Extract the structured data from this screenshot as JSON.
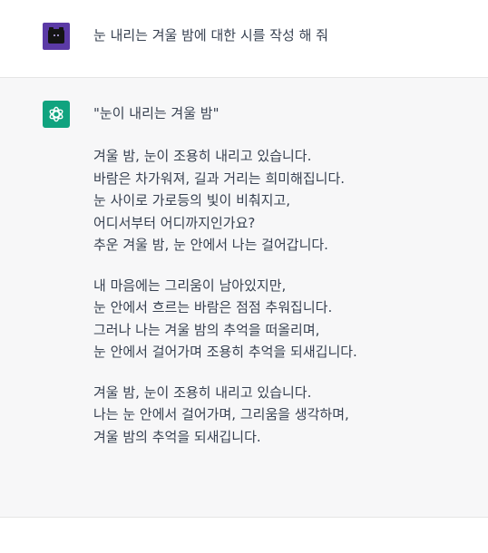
{
  "user_message": {
    "text": "눈 내리는 겨울 밤에 대한 시를 작성 해 줘",
    "avatar_color": "#5b3aa6"
  },
  "assistant_message": {
    "avatar_color": "#10a37f",
    "title": "\"눈이 내리는 겨울 밤\"",
    "stanzas": [
      {
        "lines": [
          "겨울 밤, 눈이 조용히 내리고 있습니다.",
          "바람은 차가워져, 길과 거리는 희미해집니다.",
          "눈 사이로 가로등의 빛이 비춰지고,",
          "어디서부터 어디까지인가요?",
          "추운 겨울 밤, 눈 안에서 나는 걸어갑니다."
        ]
      },
      {
        "lines": [
          "내 마음에는 그리움이 남아있지만,",
          "눈 안에서 흐르는 바람은 점점 추워집니다.",
          "그러나 나는 겨울 밤의 추억을 떠올리며,",
          "눈 안에서 걸어가며 조용히 추억을 되새깁니다."
        ]
      },
      {
        "lines": [
          "겨울 밤, 눈이 조용히 내리고 있습니다.",
          "나는 눈 안에서 걸어가며, 그리움을 생각하며,",
          "겨울 밤의 추억을 되새깁니다."
        ]
      }
    ]
  }
}
